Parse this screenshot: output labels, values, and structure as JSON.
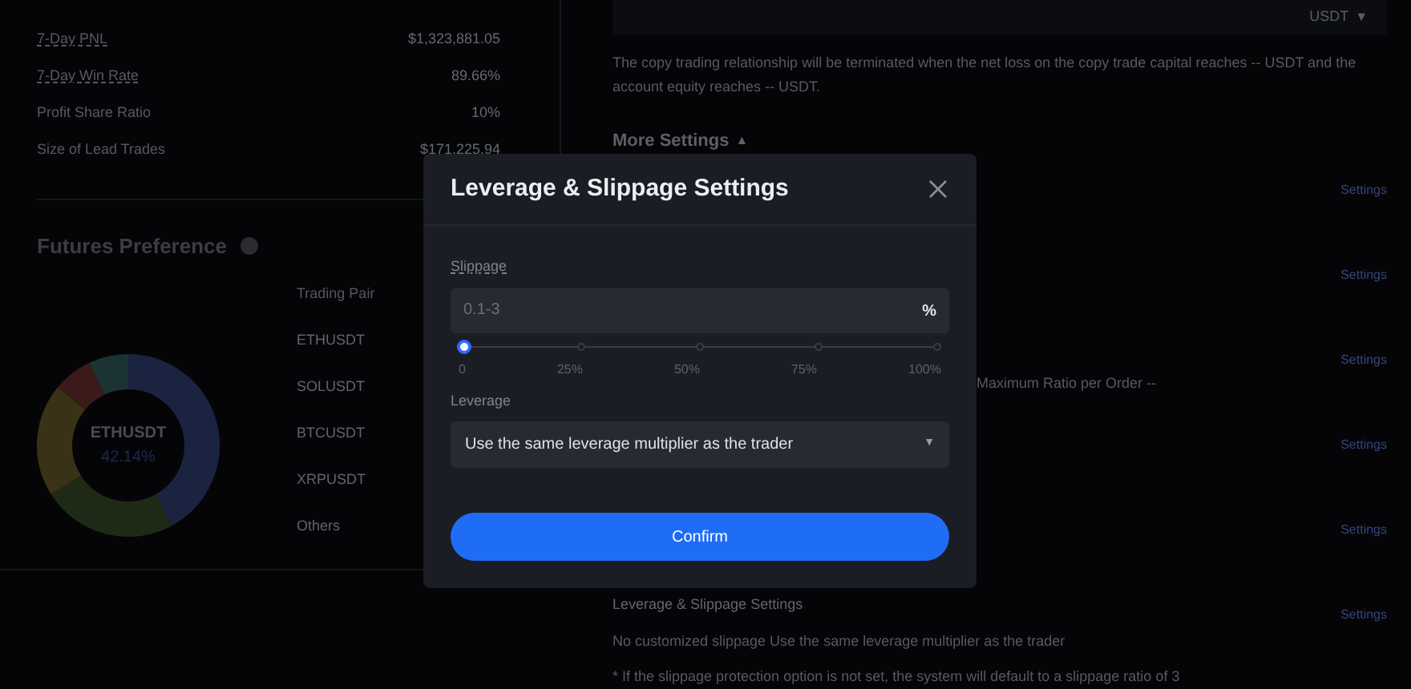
{
  "stats": [
    {
      "label": "7-Day PNL",
      "value": "$1,323,881.05"
    },
    {
      "label": "7-Day Win Rate",
      "value": "89.66%"
    },
    {
      "label": "Profit Share Ratio",
      "value": "10%"
    },
    {
      "label": "Size of Lead Trades",
      "value": "$171,225.94"
    }
  ],
  "futures_preference": {
    "title": "Futures Preference",
    "center_label": "ETHUSDT",
    "center_value": "42.14%",
    "legend_header": "Trading Pair",
    "donut_segments": [
      {
        "color": "#1a2340"
      },
      {
        "color": "#1f2a16"
      },
      {
        "color": "#3a3216"
      },
      {
        "color": "#3d1a1a"
      },
      {
        "color": "#1c3333"
      }
    ],
    "legend": [
      "ETHUSDT",
      "SOLUSDT",
      "BTCUSDT",
      "XRPUSDT",
      "Others"
    ]
  },
  "background": {
    "currency": "USDT",
    "currency_caret": "▼",
    "more_caret": "▲",
    "stop_note": "The copy trading relationship will be terminated when the net loss on the copy trade capital reaches -- USDT and the account equity reaches -- USDT.",
    "more_settings": "More Settings",
    "max_ratio": "Maximum Ratio per Order --",
    "settings_links": [
      "Settings",
      "Settings",
      "Settings",
      "Settings",
      "Settings",
      "Settings"
    ],
    "slippage_heading": "Leverage & Slippage Settings",
    "slippage_summary": "No customized slippage Use the same leverage multiplier as the trader",
    "slippage_note": "* If the slippage protection option is not set, the system will default to a slippage ratio of 3"
  },
  "modal": {
    "title": "Leverage & Slippage Settings",
    "slippage_label": "Slippage",
    "slippage_placeholder": "0.1-3",
    "unit": "%",
    "slider": {
      "level": 0,
      "marks": [
        "0",
        "25%",
        "50%",
        "75%",
        "100%"
      ]
    },
    "leverage_label": "Leverage",
    "leverage_value": "Use the same leverage multiplier as the trader",
    "leverage_caret": "▼",
    "confirm": "Confirm"
  }
}
